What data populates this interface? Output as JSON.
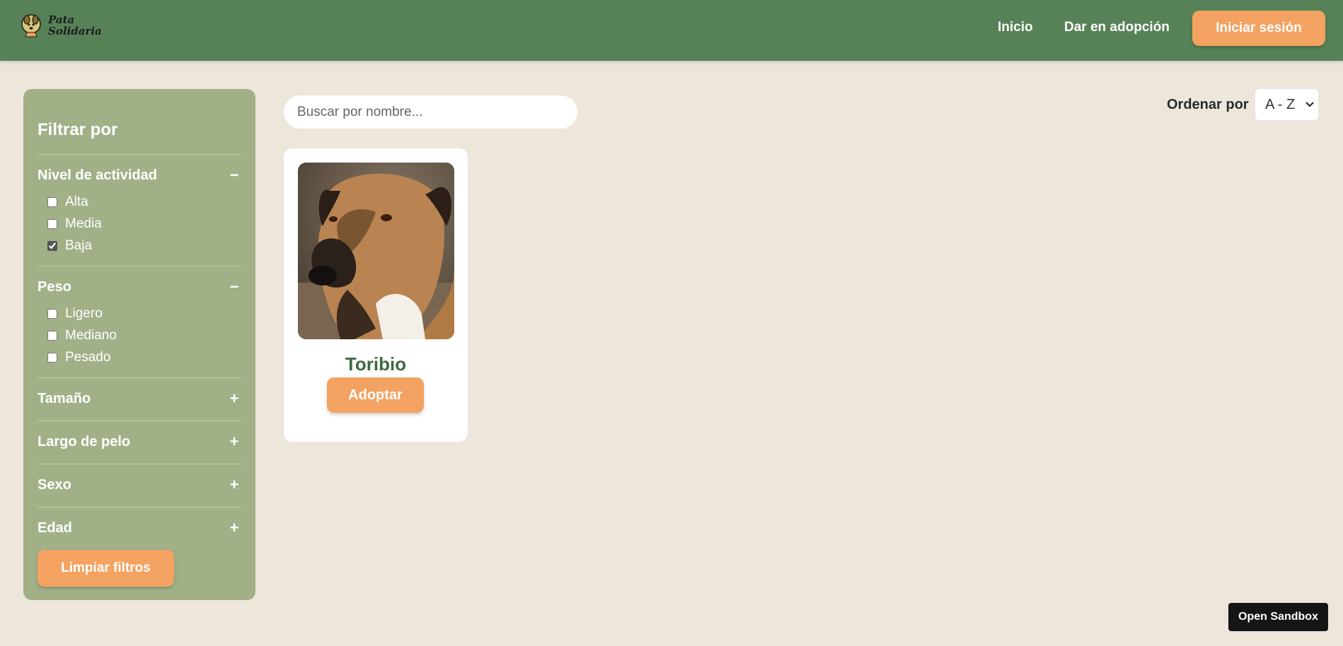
{
  "header": {
    "logo_line1": "Pata",
    "logo_line2": "Solidaria",
    "nav": {
      "home": "Inicio",
      "give_adoption": "Dar en adopción",
      "login": "Iniciar sesión"
    }
  },
  "sidebar": {
    "title": "Filtrar por",
    "activity": {
      "label": "Nivel de actividad",
      "toggle": "−",
      "options": [
        "Alta",
        "Media",
        "Baja"
      ],
      "checked": [
        false,
        false,
        true
      ]
    },
    "weight": {
      "label": "Peso",
      "toggle": "−",
      "options": [
        "Ligero",
        "Mediano",
        "Pesado"
      ],
      "checked": [
        false,
        false,
        false
      ]
    },
    "size": {
      "label": "Tamaño",
      "toggle": "+"
    },
    "hair": {
      "label": "Largo de pelo",
      "toggle": "+"
    },
    "sex": {
      "label": "Sexo",
      "toggle": "+"
    },
    "age": {
      "label": "Edad",
      "toggle": "+"
    },
    "clear_label": "Limpiar filtros"
  },
  "search": {
    "placeholder": "Buscar por nombre...",
    "value": ""
  },
  "sort": {
    "label": "Ordenar por",
    "selected": "A - Z"
  },
  "pets": [
    {
      "name": "Toribio",
      "adopt_label": "Adoptar"
    }
  ],
  "footer": {
    "sandbox_label": "Open Sandbox"
  },
  "colors": {
    "header": "#578257",
    "accent": "#f4a261",
    "sidebar": "#a2b088",
    "background": "#ede6db",
    "pet_name": "#3b6b3f"
  }
}
